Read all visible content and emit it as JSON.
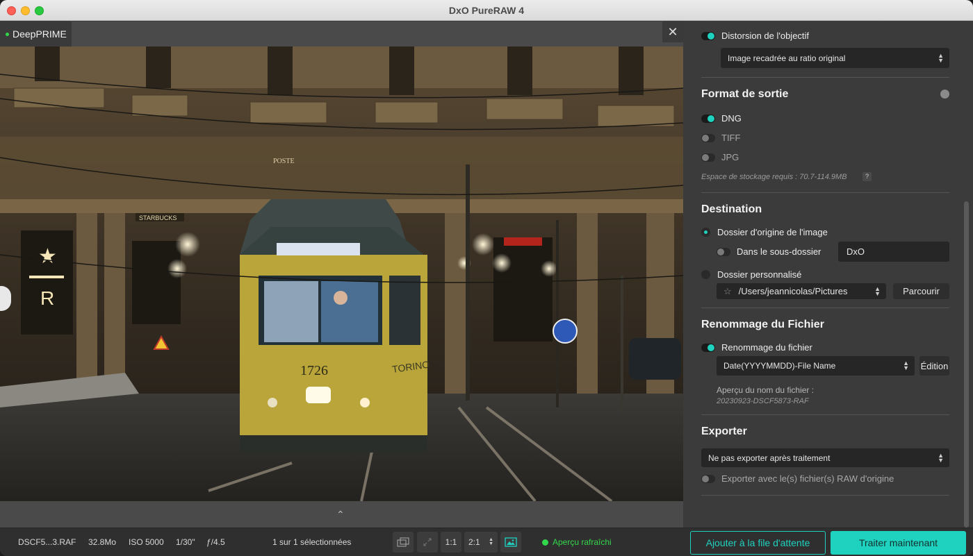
{
  "window": {
    "title": "DxO PureRAW 4"
  },
  "viewer": {
    "tab_label": "DeepPRIME",
    "close_glyph": "✕",
    "chevron": "⌃"
  },
  "panel": {
    "lens": {
      "distortion_label": "Distorsion de l'objectif",
      "distortion_on": true,
      "crop_select": "Image recadrée au ratio original"
    },
    "output_format": {
      "title": "Format de sortie",
      "dng": "DNG",
      "tiff": "TIFF",
      "jpg": "JPG",
      "storage": "Espace de stockage requis : 70.7-114.9MB",
      "help": "?"
    },
    "destination": {
      "title": "Destination",
      "origin_folder": "Dossier d'origine de l'image",
      "subfolder_label": "Dans le sous-dossier",
      "subfolder_value": "DxO",
      "custom_folder": "Dossier personnalisé",
      "path": "/Users/jeannicolas/Pictures",
      "browse": "Parcourir"
    },
    "rename": {
      "title": "Renommage du Fichier",
      "toggle_label": "Renommage du fichier",
      "pattern": "Date(YYYYMMDD)-File Name",
      "edit": "Édition",
      "preview_label": "Aperçu du nom du fichier :",
      "preview_value": "20230923-DSCF5873-RAF"
    },
    "export": {
      "title": "Exporter",
      "select": "Ne pas exporter après traitement",
      "with_raw": "Exporter avec le(s) fichier(s) RAW d'origine"
    }
  },
  "bottom": {
    "filename": "DSCF5...3.RAF",
    "size": "32.8Mo",
    "iso": "ISO 5000",
    "shutter": "1/30\"",
    "aperture": "ƒ/4.5",
    "selection": "1 sur 1 sélectionnées",
    "zoom_1_1": "1:1",
    "zoom_2_1": "2:1",
    "preview_status": "Aperçu rafraîchi",
    "queue_button": "Ajouter à la file d'attente",
    "process_button": "Traiter maintenant"
  },
  "colors": {
    "accent": "#1fd2c0",
    "status_green": "#32d74b"
  },
  "icons": {
    "compare": "compare-icon",
    "fit": "fit-to-screen-icon",
    "preview_image": "image-preview-icon",
    "star": "star-icon",
    "help": "help-icon"
  }
}
